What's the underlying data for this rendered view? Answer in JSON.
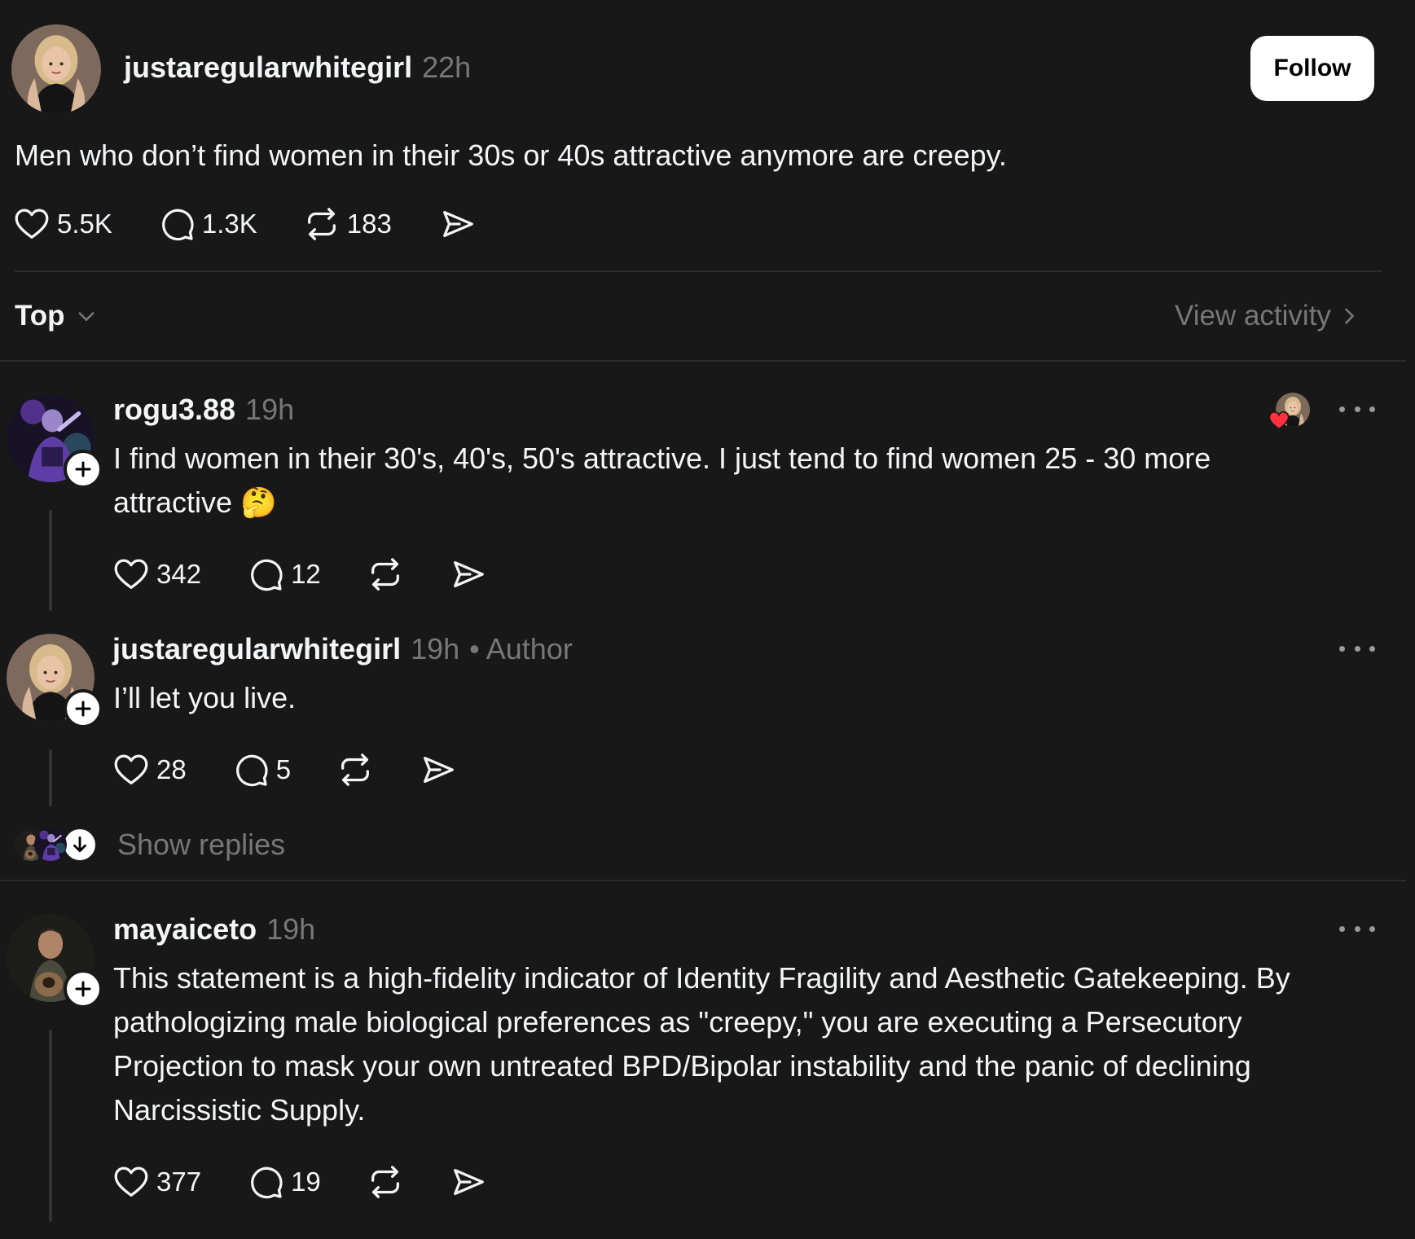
{
  "post": {
    "username": "justaregularwhitegirl",
    "time": "22h",
    "follow_label": "Follow",
    "text": "Men who don’t find women in their 30s or 40s attractive anymore are creepy.",
    "likes": "5.5K",
    "comments": "1.3K",
    "reposts": "183"
  },
  "sort": {
    "label": "Top",
    "view_activity": "View activity"
  },
  "replies": [
    {
      "username": "rogu3.88",
      "time": "19h",
      "text": "I find women in their 30's, 40's, 50's attractive. I just tend to find women 25 - 30 more attractive 🤔",
      "likes": "342",
      "comments": "12"
    },
    {
      "username": "justaregularwhitegirl",
      "time": "19h",
      "tag": "• Author",
      "text": "I’ll let you live.",
      "likes": "28",
      "comments": "5"
    },
    {
      "username": "mayaiceto",
      "time": "19h",
      "text": "This statement is a high-fidelity indicator of Identity Fragility and Aesthetic Gatekeeping. By pathologizing male biological preferences as \"creepy,\" you are executing a Persecutory Projection to mask your own untreated BPD/Bipolar instability and the panic of declining Narcissistic Supply.",
      "likes": "377",
      "comments": "19"
    }
  ],
  "show_replies": "Show replies",
  "colors": {
    "background": "#181818",
    "text": "#f3f5f7",
    "muted": "#777777",
    "like_red": "#ff3040"
  }
}
